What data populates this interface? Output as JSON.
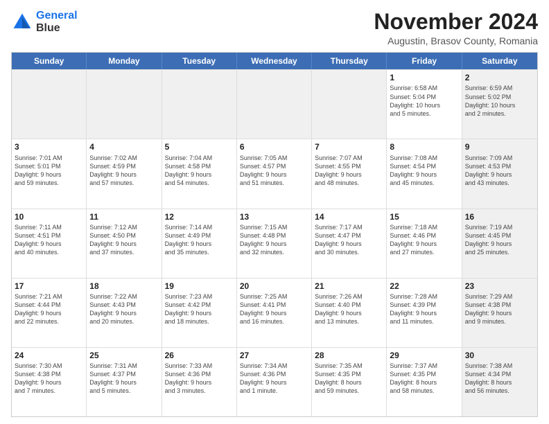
{
  "logo": {
    "line1": "General",
    "line2": "Blue"
  },
  "title": "November 2024",
  "subtitle": "Augustin, Brasov County, Romania",
  "days": [
    "Sunday",
    "Monday",
    "Tuesday",
    "Wednesday",
    "Thursday",
    "Friday",
    "Saturday"
  ],
  "weeks": [
    [
      {
        "day": "",
        "info": "",
        "shaded": true
      },
      {
        "day": "",
        "info": "",
        "shaded": true
      },
      {
        "day": "",
        "info": "",
        "shaded": true
      },
      {
        "day": "",
        "info": "",
        "shaded": true
      },
      {
        "day": "",
        "info": "",
        "shaded": true
      },
      {
        "day": "1",
        "info": "Sunrise: 6:58 AM\nSunset: 5:04 PM\nDaylight: 10 hours\nand 5 minutes.",
        "shaded": false
      },
      {
        "day": "2",
        "info": "Sunrise: 6:59 AM\nSunset: 5:02 PM\nDaylight: 10 hours\nand 2 minutes.",
        "shaded": true
      }
    ],
    [
      {
        "day": "3",
        "info": "Sunrise: 7:01 AM\nSunset: 5:01 PM\nDaylight: 9 hours\nand 59 minutes.",
        "shaded": false
      },
      {
        "day": "4",
        "info": "Sunrise: 7:02 AM\nSunset: 4:59 PM\nDaylight: 9 hours\nand 57 minutes.",
        "shaded": false
      },
      {
        "day": "5",
        "info": "Sunrise: 7:04 AM\nSunset: 4:58 PM\nDaylight: 9 hours\nand 54 minutes.",
        "shaded": false
      },
      {
        "day": "6",
        "info": "Sunrise: 7:05 AM\nSunset: 4:57 PM\nDaylight: 9 hours\nand 51 minutes.",
        "shaded": false
      },
      {
        "day": "7",
        "info": "Sunrise: 7:07 AM\nSunset: 4:55 PM\nDaylight: 9 hours\nand 48 minutes.",
        "shaded": false
      },
      {
        "day": "8",
        "info": "Sunrise: 7:08 AM\nSunset: 4:54 PM\nDaylight: 9 hours\nand 45 minutes.",
        "shaded": false
      },
      {
        "day": "9",
        "info": "Sunrise: 7:09 AM\nSunset: 4:53 PM\nDaylight: 9 hours\nand 43 minutes.",
        "shaded": true
      }
    ],
    [
      {
        "day": "10",
        "info": "Sunrise: 7:11 AM\nSunset: 4:51 PM\nDaylight: 9 hours\nand 40 minutes.",
        "shaded": false
      },
      {
        "day": "11",
        "info": "Sunrise: 7:12 AM\nSunset: 4:50 PM\nDaylight: 9 hours\nand 37 minutes.",
        "shaded": false
      },
      {
        "day": "12",
        "info": "Sunrise: 7:14 AM\nSunset: 4:49 PM\nDaylight: 9 hours\nand 35 minutes.",
        "shaded": false
      },
      {
        "day": "13",
        "info": "Sunrise: 7:15 AM\nSunset: 4:48 PM\nDaylight: 9 hours\nand 32 minutes.",
        "shaded": false
      },
      {
        "day": "14",
        "info": "Sunrise: 7:17 AM\nSunset: 4:47 PM\nDaylight: 9 hours\nand 30 minutes.",
        "shaded": false
      },
      {
        "day": "15",
        "info": "Sunrise: 7:18 AM\nSunset: 4:46 PM\nDaylight: 9 hours\nand 27 minutes.",
        "shaded": false
      },
      {
        "day": "16",
        "info": "Sunrise: 7:19 AM\nSunset: 4:45 PM\nDaylight: 9 hours\nand 25 minutes.",
        "shaded": true
      }
    ],
    [
      {
        "day": "17",
        "info": "Sunrise: 7:21 AM\nSunset: 4:44 PM\nDaylight: 9 hours\nand 22 minutes.",
        "shaded": false
      },
      {
        "day": "18",
        "info": "Sunrise: 7:22 AM\nSunset: 4:43 PM\nDaylight: 9 hours\nand 20 minutes.",
        "shaded": false
      },
      {
        "day": "19",
        "info": "Sunrise: 7:23 AM\nSunset: 4:42 PM\nDaylight: 9 hours\nand 18 minutes.",
        "shaded": false
      },
      {
        "day": "20",
        "info": "Sunrise: 7:25 AM\nSunset: 4:41 PM\nDaylight: 9 hours\nand 16 minutes.",
        "shaded": false
      },
      {
        "day": "21",
        "info": "Sunrise: 7:26 AM\nSunset: 4:40 PM\nDaylight: 9 hours\nand 13 minutes.",
        "shaded": false
      },
      {
        "day": "22",
        "info": "Sunrise: 7:28 AM\nSunset: 4:39 PM\nDaylight: 9 hours\nand 11 minutes.",
        "shaded": false
      },
      {
        "day": "23",
        "info": "Sunrise: 7:29 AM\nSunset: 4:38 PM\nDaylight: 9 hours\nand 9 minutes.",
        "shaded": true
      }
    ],
    [
      {
        "day": "24",
        "info": "Sunrise: 7:30 AM\nSunset: 4:38 PM\nDaylight: 9 hours\nand 7 minutes.",
        "shaded": false
      },
      {
        "day": "25",
        "info": "Sunrise: 7:31 AM\nSunset: 4:37 PM\nDaylight: 9 hours\nand 5 minutes.",
        "shaded": false
      },
      {
        "day": "26",
        "info": "Sunrise: 7:33 AM\nSunset: 4:36 PM\nDaylight: 9 hours\nand 3 minutes.",
        "shaded": false
      },
      {
        "day": "27",
        "info": "Sunrise: 7:34 AM\nSunset: 4:36 PM\nDaylight: 9 hours\nand 1 minute.",
        "shaded": false
      },
      {
        "day": "28",
        "info": "Sunrise: 7:35 AM\nSunset: 4:35 PM\nDaylight: 8 hours\nand 59 minutes.",
        "shaded": false
      },
      {
        "day": "29",
        "info": "Sunrise: 7:37 AM\nSunset: 4:35 PM\nDaylight: 8 hours\nand 58 minutes.",
        "shaded": false
      },
      {
        "day": "30",
        "info": "Sunrise: 7:38 AM\nSunset: 4:34 PM\nDaylight: 8 hours\nand 56 minutes.",
        "shaded": true
      }
    ]
  ]
}
